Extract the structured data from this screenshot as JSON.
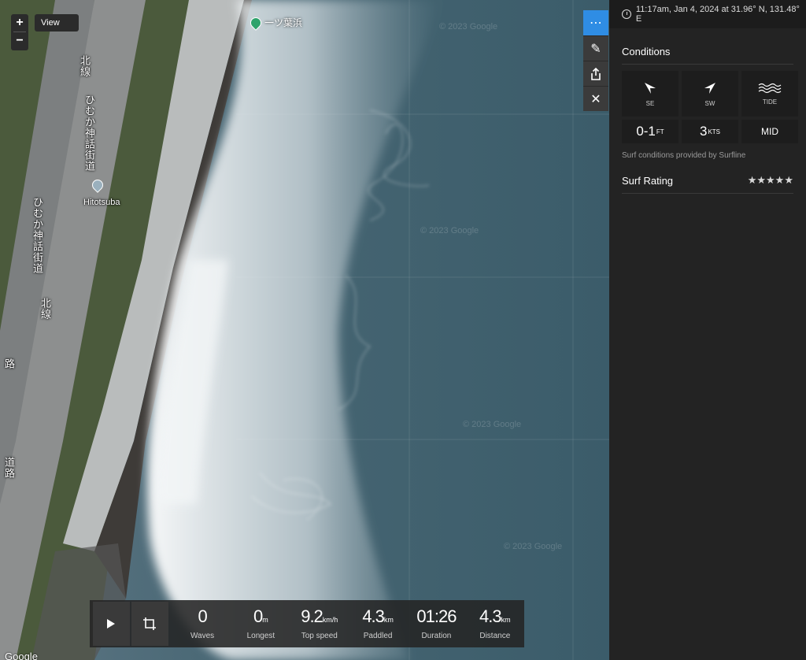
{
  "map": {
    "zoom_in": "+",
    "zoom_out": "−",
    "view_label": "View",
    "place_label": "一ツ葉浜",
    "poi_label": "Hitotsuba",
    "road_labels": [
      "北線",
      "ひむか神話街道",
      "ひむか神話街道",
      "北線",
      "路",
      "道路"
    ],
    "watermark": "© 2023 Google",
    "google_logo": "Google"
  },
  "tools": {
    "more": "⋯",
    "edit": "✎",
    "share": "⇪",
    "close": "✕"
  },
  "stats": {
    "items": [
      {
        "value": "0",
        "unit": "",
        "label": "Waves"
      },
      {
        "value": "0",
        "unit": "m",
        "label": "Longest"
      },
      {
        "value": "9.2",
        "unit": "km/h",
        "label": "Top speed"
      },
      {
        "value": "4.3",
        "unit": "km",
        "label": "Paddled"
      },
      {
        "value": "01:26",
        "unit": "",
        "label": "Duration"
      },
      {
        "value": "4.3",
        "unit": "km",
        "label": "Distance"
      }
    ]
  },
  "panel": {
    "header": "11:17am, Jan 4, 2024 at 31.96° N, 131.48° E",
    "conditions_title": "Conditions",
    "swell_dir": "SE",
    "wind_dir": "SW",
    "tide_label": "TIDE",
    "wave_height": "0-1",
    "wave_unit": "FT",
    "wind_speed": "3",
    "wind_unit": "KTS",
    "tide_value": "MID",
    "surfline_note": "Surf conditions provided by Surfline",
    "rating_title": "Surf Rating",
    "rating_stars": "★★★★★"
  },
  "colors": {
    "accent": "#2f8de4",
    "panel_bg": "#232323",
    "pin_green": "#2ea36b"
  }
}
